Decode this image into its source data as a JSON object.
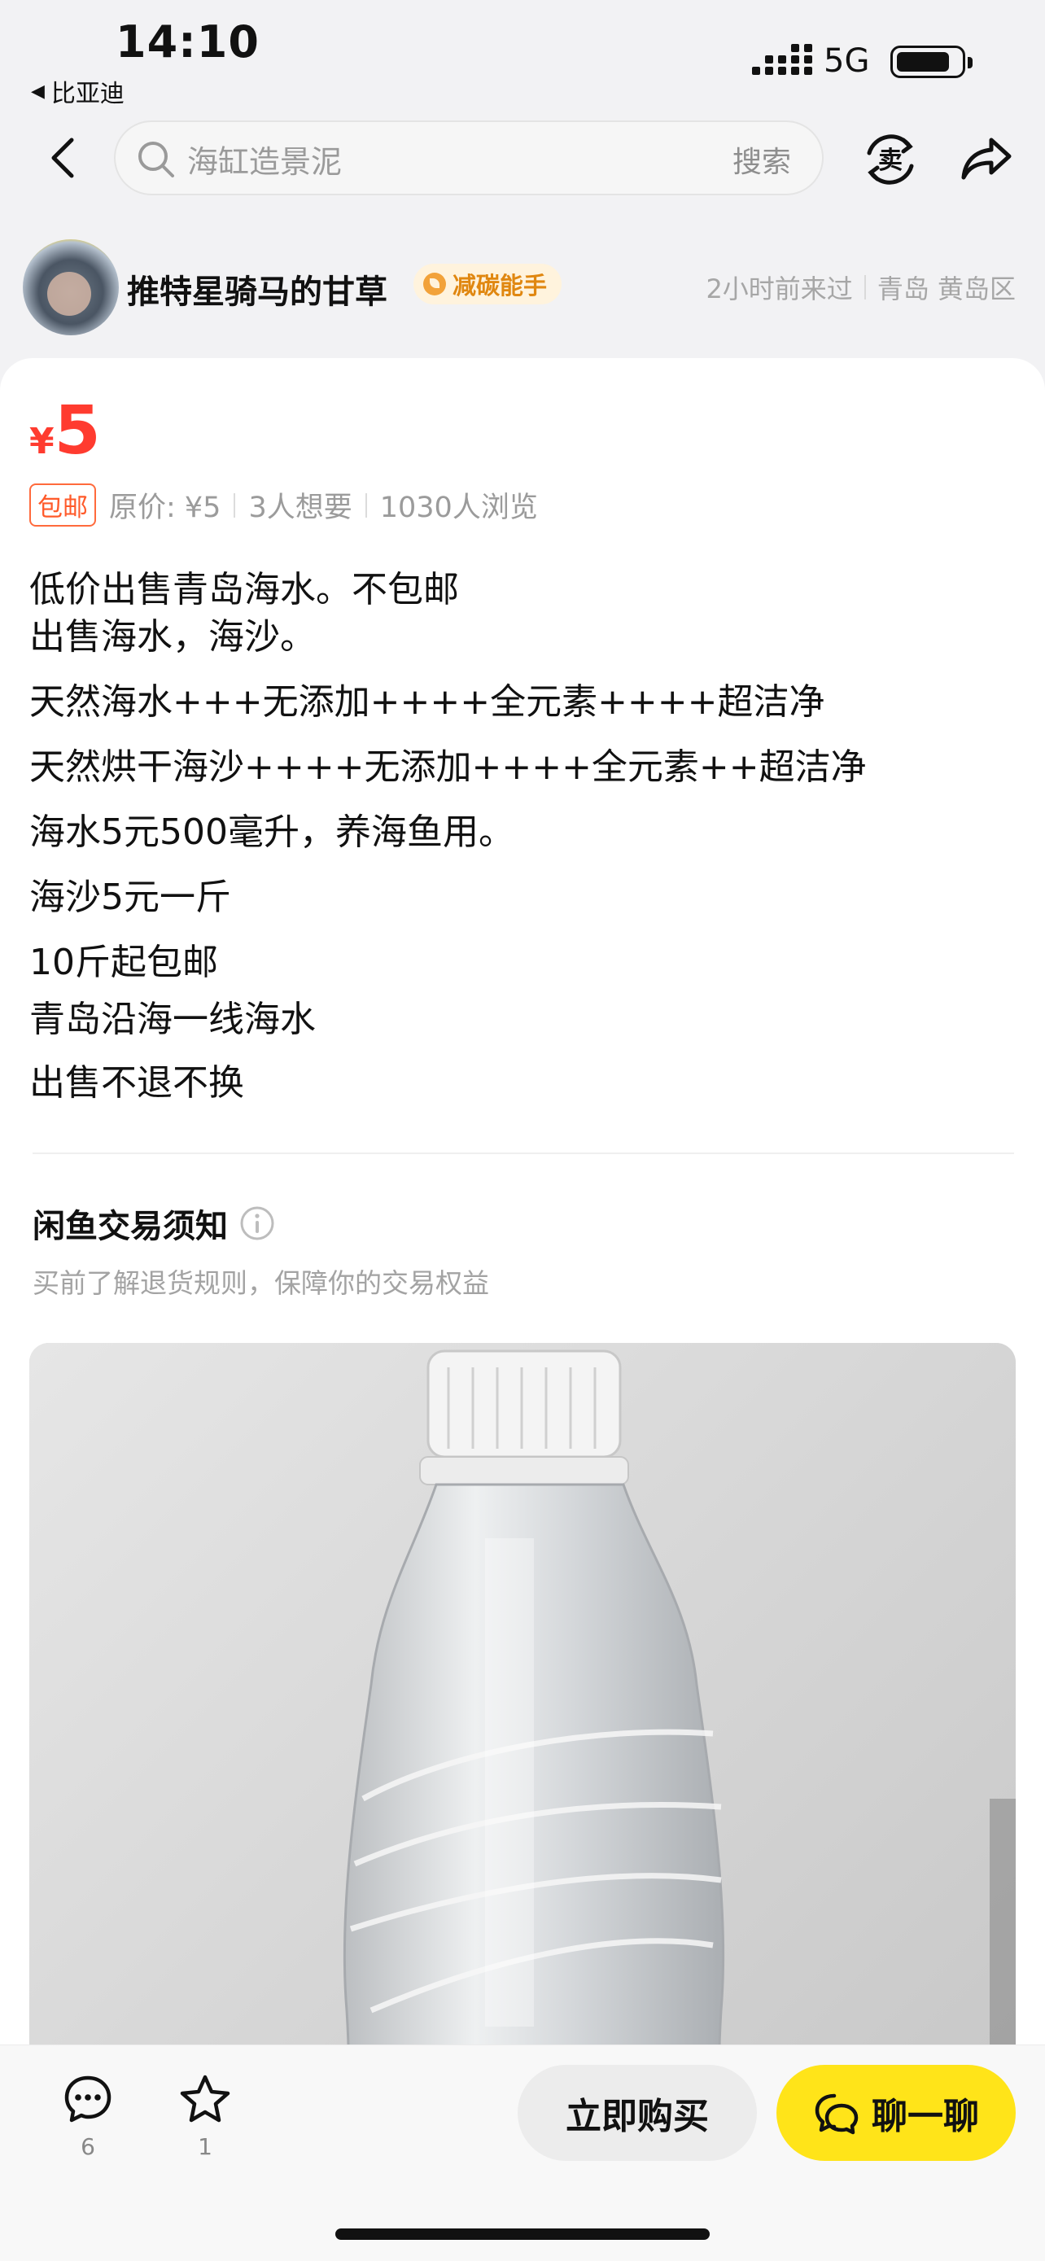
{
  "status_bar": {
    "time": "14:10",
    "back_app": "比亚迪",
    "network": "5G"
  },
  "nav": {
    "search_placeholder": "海缸造景泥",
    "search_button": "搜索",
    "icons": [
      "back-chevron-icon",
      "search-icon",
      "sell-icon",
      "share-icon"
    ]
  },
  "seller": {
    "name": "推特星骑马的甘草",
    "badge": "减碳能手",
    "last_seen": "2小时前来过",
    "location": "青岛 黄岛区"
  },
  "listing": {
    "price_currency": "¥",
    "price": "5",
    "free_shipping_tag": "包邮",
    "original_price": "原价: ¥5",
    "wants": "3人想要",
    "views": "1030人浏览",
    "description": [
      "低价出售青岛海水。不包邮",
      "出售海水，海沙。",
      "天然海水+++无添加++++全元素++++超洁净",
      "天然烘干海沙++++无添加++++全元素++超洁净",
      "海水5元500毫升，养海鱼用。",
      "海沙5元一斤",
      "10斤起包邮",
      "青岛沿海一线海水",
      "出售不退不换"
    ]
  },
  "notice": {
    "title": "闲鱼交易须知",
    "subtitle": "买前了解退货规则，保障你的交易权益"
  },
  "bottom_bar": {
    "comments_count": "6",
    "favorites_count": "1",
    "buy_label": "立即购买",
    "chat_label": "聊一聊"
  },
  "colors": {
    "price_red": "#ff3b2f",
    "chat_yellow": "#ffe419",
    "badge_orange": "#e08710"
  }
}
